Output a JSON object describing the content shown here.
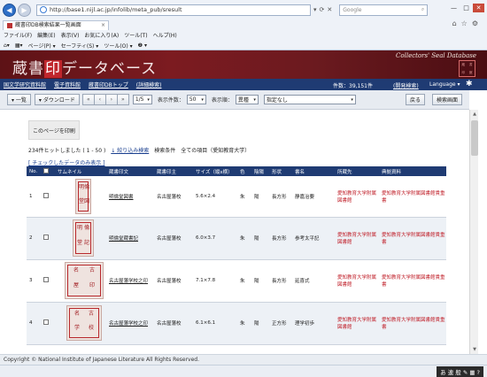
{
  "browser": {
    "url": "http://base1.nijl.ac.jp/infolib/meta_pub/sresult",
    "search_placeholder": "Google",
    "tab_title": "蔵書印DB検索結果一覧画面",
    "window_controls": [
      "—",
      "□",
      "✕"
    ],
    "right_icons": [
      "⌂",
      "☆",
      "⚙"
    ],
    "menu": [
      "ファイル(F)",
      "編集(E)",
      "表示(V)",
      "お気に入り(A)",
      "ツール(T)",
      "ヘルプ(H)"
    ],
    "command_bar": [
      "ページ(P) ▾",
      "セーフティ(S) ▾",
      "ツール(O) ▾",
      "❷ ▾"
    ]
  },
  "header": {
    "title_prefix": "蔵書",
    "title_in": "印",
    "title_suffix": "データベース",
    "subtitle_en": "Collectors' Seal Database",
    "stamp_chars": [
      "蔵",
      "書",
      "印",
      "館"
    ]
  },
  "navbar": {
    "links": [
      "国文学研究資料館",
      "電子資料館",
      "蔵書印DBトップ",
      "(詳細検索)"
    ],
    "count": "件数：39,151件",
    "admin": "(開発検索)",
    "language": "Language ▾"
  },
  "toolbar": {
    "list_btn": "▾ 一覧",
    "download_btn": "▾ ダウンロード",
    "pager": [
      "«",
      "‹",
      "›",
      "»"
    ],
    "page_select": "1/5",
    "per_page_label": "表示件数：",
    "per_page_value": "50",
    "sort_label": "表示順：",
    "sort_field": "異種",
    "sort_order": "指定なし",
    "back_btn": "戻る",
    "search_screen_btn": "検索画面"
  },
  "results": {
    "print_btn": "このページを印刷",
    "hits": "234件ヒットしました ( 1 - 50 )",
    "refine_link": "↓ 絞り込み検索",
    "condition": "検索条件　全ての項目（愛知教育大学）",
    "checked_link": "[ チェックしたデータのみ表示 ]",
    "columns": [
      "No.",
      "",
      "サムネイル",
      "蔵書印文",
      "蔵書印主",
      "サイズ（縦x横）",
      "色",
      "陰陽",
      "形状",
      "書名",
      "所蔵先",
      "典拠資料"
    ],
    "rows": [
      {
        "no": "1",
        "seal_text": "明倫堂図書",
        "owner": "名古屋藩校",
        "size": "5.6×2.4",
        "color": "朱",
        "yinyang": "陽",
        "shape": "長方形",
        "book": "静嘉治要",
        "holder": "愛知教育大学附属図書館",
        "source": "愛知教育大学附属図書館貴重書",
        "glyphs": [
          "明",
          "倫",
          "堂",
          "図"
        ]
      },
      {
        "no": "2",
        "seal_text": "明倫堂蔵書記",
        "owner": "名古屋藩校",
        "size": "6.0×3.7",
        "color": "朱",
        "yinyang": "陽",
        "shape": "長方形",
        "book": "参考太平記",
        "holder": "愛知教育大学附属図書館",
        "source": "愛知教育大学附属図書館貴重書",
        "glyphs": [
          "明",
          "倫",
          "堂",
          "記"
        ]
      },
      {
        "no": "3",
        "seal_text": "名古屋藩学校之印",
        "owner": "名古屋藩校",
        "size": "7.1×7.8",
        "color": "朱",
        "yinyang": "陽",
        "shape": "長方形",
        "book": "延喜式",
        "holder": "愛知教育大学附属図書館",
        "source": "愛知教育大学附属図書館貴重書",
        "glyphs": [
          "名",
          "古",
          "屋",
          "印"
        ]
      },
      {
        "no": "4",
        "seal_text": "名古屋藩学校之印",
        "owner": "名古屋藩校",
        "size": "6.1×6.1",
        "color": "朱",
        "yinyang": "陽",
        "shape": "正方形",
        "book": "理学初歩",
        "holder": "愛知教育大学附属図書館",
        "source": "愛知教育大学附属図書館貴重書",
        "glyphs": [
          "名",
          "古",
          "学",
          "校"
        ]
      }
    ]
  },
  "footer": {
    "copyright": "Copyright © National Institute of Japanese Literature All Rights Reserved."
  },
  "status": {
    "ime": "あ 連 般 ✎ ▦ ?"
  }
}
